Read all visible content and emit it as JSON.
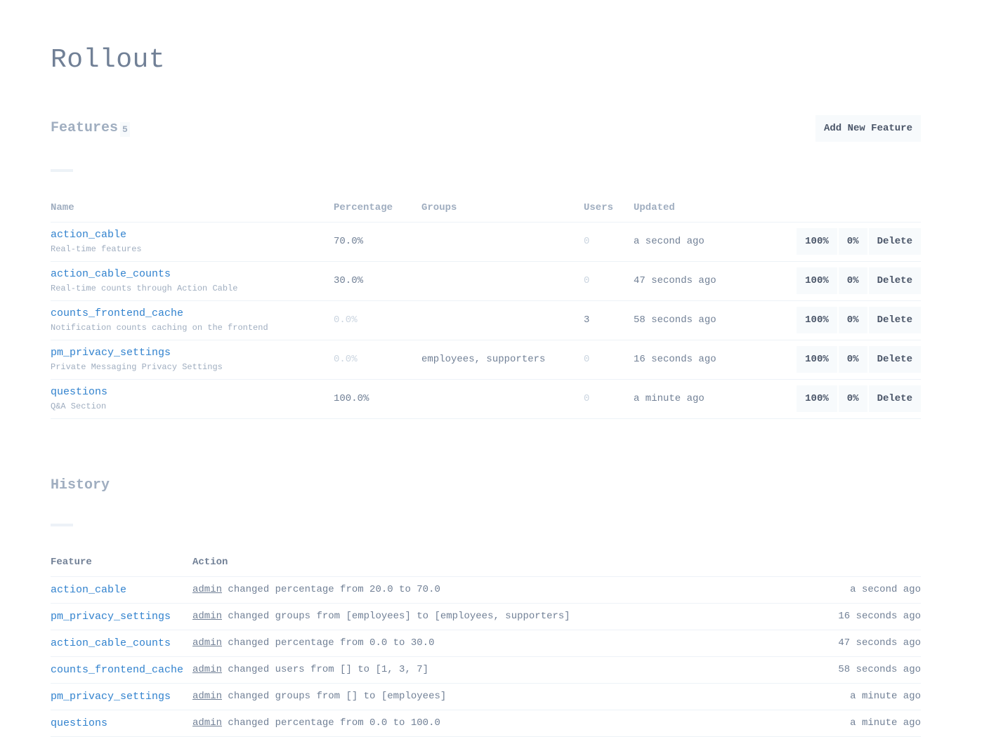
{
  "page": {
    "title": "Rollout"
  },
  "features": {
    "section_title": "Features",
    "count": "5",
    "add_button": "Add New Feature",
    "columns": {
      "name": "Name",
      "percentage": "Percentage",
      "groups": "Groups",
      "users": "Users",
      "updated": "Updated"
    },
    "action_labels": {
      "full": "100%",
      "zero": "0%",
      "delete": "Delete"
    },
    "rows": [
      {
        "name": "action_cable",
        "description": "Real-time features",
        "percentage": "70.0%",
        "groups": "",
        "users": "0",
        "updated": "a second ago"
      },
      {
        "name": "action_cable_counts",
        "description": "Real-time counts through Action Cable",
        "percentage": "30.0%",
        "groups": "",
        "users": "0",
        "updated": "47 seconds ago"
      },
      {
        "name": "counts_frontend_cache",
        "description": "Notification counts caching on the frontend",
        "percentage": "0.0%",
        "groups": "",
        "users": "3",
        "updated": "58 seconds ago"
      },
      {
        "name": "pm_privacy_settings",
        "description": "Private Messaging Privacy Settings",
        "percentage": "0.0%",
        "groups": "employees, supporters",
        "users": "0",
        "updated": "16 seconds ago"
      },
      {
        "name": "questions",
        "description": "Q&A Section",
        "percentage": "100.0%",
        "groups": "",
        "users": "0",
        "updated": "a minute ago"
      }
    ]
  },
  "history": {
    "section_title": "History",
    "columns": {
      "feature": "Feature",
      "action": "Action"
    },
    "rows": [
      {
        "feature": "action_cable",
        "actor": "admin",
        "action": "changed percentage from 20.0 to 70.0",
        "when": "a second ago"
      },
      {
        "feature": "pm_privacy_settings",
        "actor": "admin",
        "action": "changed groups from [employees] to [employees, supporters]",
        "when": "16 seconds ago"
      },
      {
        "feature": "action_cable_counts",
        "actor": "admin",
        "action": "changed percentage from 0.0 to 30.0",
        "when": "47 seconds ago"
      },
      {
        "feature": "counts_frontend_cache",
        "actor": "admin",
        "action": "changed users from [] to [1, 3, 7]",
        "when": "58 seconds ago"
      },
      {
        "feature": "pm_privacy_settings",
        "actor": "admin",
        "action": "changed groups from [] to [employees]",
        "when": "a minute ago"
      },
      {
        "feature": "questions",
        "actor": "admin",
        "action": "changed percentage from 0.0 to 100.0",
        "when": "a minute ago"
      }
    ]
  }
}
